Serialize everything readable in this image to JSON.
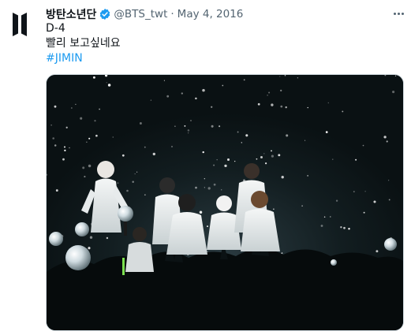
{
  "tweet": {
    "display_name": "방탄소년단",
    "handle": "@BTS_twt",
    "separator": "·",
    "date": "May 4, 2016",
    "verified": true,
    "text_line1": "D-4",
    "text_line2": "빨리 보고싶네요",
    "hashtag": "#JIMIN"
  },
  "icons": {
    "avatar": "bts-logo-icon",
    "verified": "verified-badge-icon",
    "more": "more-options-icon"
  },
  "colors": {
    "accent": "#1d9bf0",
    "secondary_text": "#536471",
    "photo_background": "#0c1416"
  }
}
